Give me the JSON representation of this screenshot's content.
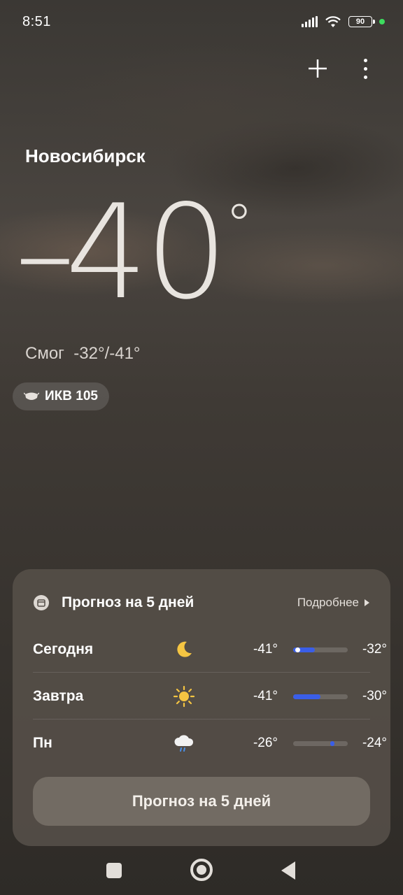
{
  "status_bar": {
    "time": "8:51",
    "battery": "90",
    "icons": [
      "signal-icon",
      "wifi-icon",
      "battery-icon",
      "privacy-dot-icon"
    ],
    "privacy_dot_color": "#3ddc5e"
  },
  "toolbar": {
    "add_icon": "plus-icon",
    "menu_icon": "more-vertical-icon"
  },
  "location": {
    "city": "Новосибирск"
  },
  "current": {
    "temp_sign": "-",
    "temp_value": "40",
    "degree": "°",
    "condition": "Смог",
    "hi_lo": "-32°/-41°"
  },
  "aqi": {
    "label": "ИКВ 105",
    "icon": "mask-icon"
  },
  "forecast": {
    "title": "Прогноз на 5 дней",
    "more_label": "Подробнее",
    "calendar_icon": "calendar-icon",
    "days": [
      {
        "name": "Сегодня",
        "icon": "moon-icon",
        "min": "-41°",
        "max": "-32°",
        "bar_start": 0.0,
        "bar_end": 0.4,
        "dot": 0.05
      },
      {
        "name": "Завтра",
        "icon": "sun-icon",
        "min": "-41°",
        "max": "-30°",
        "bar_start": 0.0,
        "bar_end": 0.5,
        "dot": null
      },
      {
        "name": "Пн",
        "icon": "rain-cloud-icon",
        "min": "-26°",
        "max": "-24°",
        "bar_start": 0.68,
        "bar_end": 0.76,
        "dot": null
      }
    ],
    "button_label": "Прогноз на 5 дней",
    "bar_color": "#3a5ee8"
  },
  "nav": {
    "icons": [
      "recent-apps-icon",
      "home-icon",
      "back-icon"
    ]
  }
}
